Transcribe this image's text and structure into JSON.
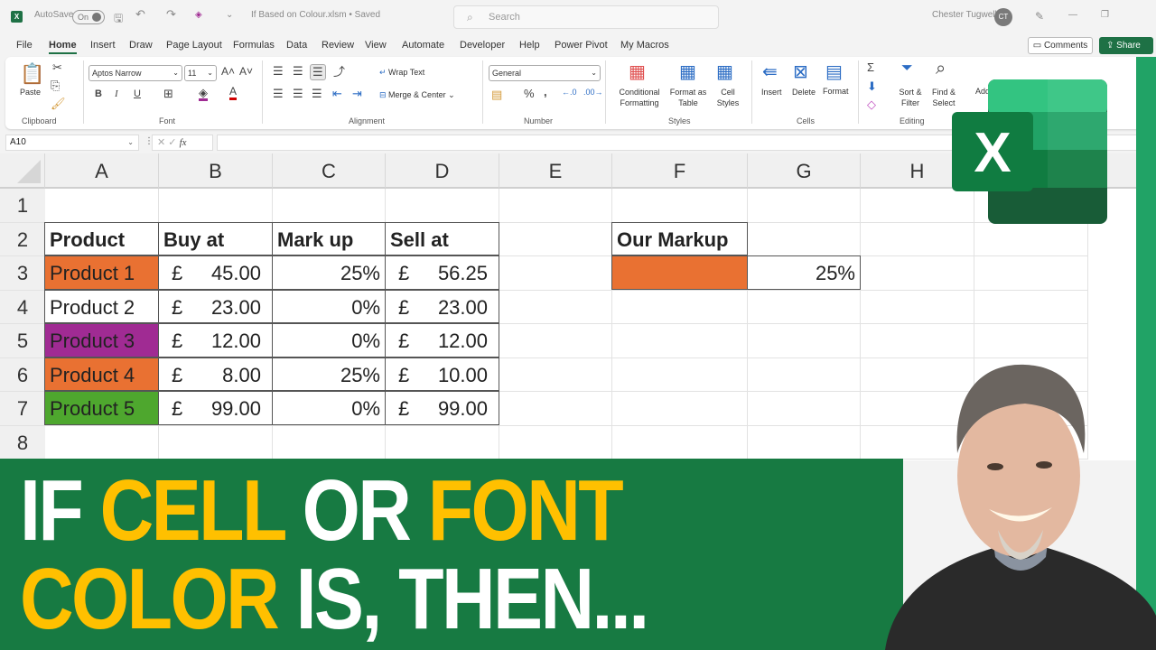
{
  "titlebar": {
    "autosave_label": "AutoSave",
    "autosave_state": "On",
    "filename": "If Based on Colour.xlsm • Saved",
    "search_placeholder": "Search",
    "user_name": "Chester Tugwell",
    "user_initials": "CT"
  },
  "menu": {
    "tabs": [
      "File",
      "Home",
      "Insert",
      "Draw",
      "Page Layout",
      "Formulas",
      "Data",
      "Review",
      "View",
      "Automate",
      "Developer",
      "Help",
      "Power Pivot",
      "My Macros"
    ],
    "active": "Home",
    "comments_label": "Comments",
    "share_label": "Share"
  },
  "ribbon": {
    "clipboard": {
      "label": "Clipboard",
      "paste": "Paste"
    },
    "font": {
      "label": "Font",
      "font_name": "Aptos Narrow",
      "font_size": "11",
      "bold": "B",
      "italic": "I",
      "underline": "U"
    },
    "alignment": {
      "label": "Alignment",
      "wrap_text": "Wrap Text",
      "merge_center": "Merge & Center"
    },
    "number": {
      "label": "Number",
      "format": "General"
    },
    "styles": {
      "label": "Styles",
      "conditional_formatting": "Conditional Formatting",
      "format_as_table": "Format as Table",
      "cell_styles": "Cell Styles"
    },
    "cells": {
      "label": "Cells",
      "insert": "Insert",
      "delete": "Delete",
      "format": "Format"
    },
    "editing": {
      "label": "Editing",
      "sort_filter": "Sort & Filter",
      "find_select": "Find & Select"
    },
    "addins": "Add-ins"
  },
  "formula_bar": {
    "name_box": "A10",
    "fx": "fx",
    "formula": ""
  },
  "sheet": {
    "columns": [
      "A",
      "B",
      "C",
      "D",
      "E",
      "F",
      "G",
      "H"
    ],
    "rows": [
      "1",
      "2",
      "3",
      "4",
      "5",
      "6",
      "7",
      "8"
    ],
    "headers": {
      "product": "Product",
      "buy_at": "Buy at",
      "mark_up": "Mark up",
      "sell_at": "Sell at"
    },
    "currency_symbol": "£",
    "data": [
      {
        "product": "Product 1",
        "fill": "#e97132",
        "buy": "45.00",
        "markup": "25%",
        "sell": "56.25"
      },
      {
        "product": "Product 2",
        "fill": "#ffffff",
        "buy": "23.00",
        "markup": "0%",
        "sell": "23.00"
      },
      {
        "product": "Product 3",
        "fill": "#a02b93",
        "buy": "12.00",
        "markup": "0%",
        "sell": "12.00"
      },
      {
        "product": "Product 4",
        "fill": "#e97132",
        "buy": "8.00",
        "markup": "25%",
        "sell": "10.00"
      },
      {
        "product": "Product 5",
        "fill": "#4ea72e",
        "buy": "99.00",
        "markup": "0%",
        "sell": "99.00"
      }
    ],
    "our_markup": {
      "label": "Our Markup",
      "fill": "#e97132",
      "value": "25%"
    }
  },
  "banner": {
    "line1": [
      {
        "text": "IF ",
        "color": "white"
      },
      {
        "text": "CELL ",
        "color": "yellow"
      },
      {
        "text": "OR ",
        "color": "white"
      },
      {
        "text": "FONT",
        "color": "yellow"
      }
    ],
    "line2": [
      {
        "text": "COLOR ",
        "color": "yellow"
      },
      {
        "text": "IS, THEN...",
        "color": "white"
      }
    ],
    "bg_color": "#177a42",
    "accent_color": "#ffc000"
  }
}
